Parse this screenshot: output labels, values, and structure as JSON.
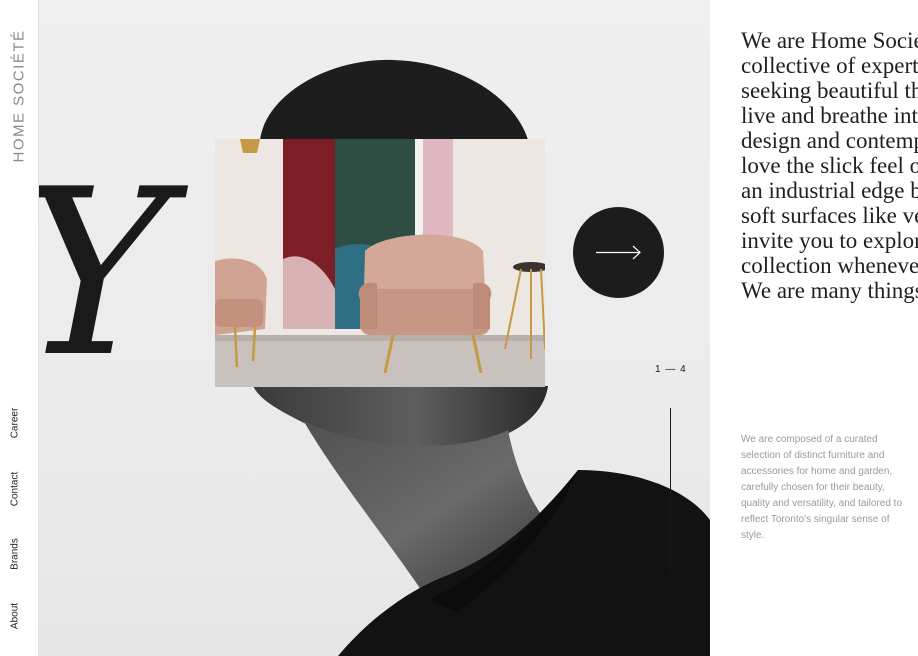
{
  "brand": {
    "logo_text": "HOME SOCIÉTÉ"
  },
  "nav": {
    "items": [
      {
        "label": "Career"
      },
      {
        "label": "Contact"
      },
      {
        "label": "Brands"
      },
      {
        "label": "About"
      }
    ]
  },
  "hero": {
    "big_letter": "Y",
    "next_icon": "arrow-right-icon",
    "pager": "1 — 4"
  },
  "intro": {
    "text": "We are Home Société, a collective of expertise while seeking beautiful things. We live and breathe international design and contemporary. We love the slick feel of metal and an industrial edge but we like soft surfaces like velvet, too. We invite you to explore and the collection whenever you need it. We are many things."
  },
  "description": {
    "text": "We are composed of a curated selection of distinct furniture and accessories for home and garden, carefully chosen for their beauty, quality and versatility, and tailored to reflect Toronto's singular sense of style."
  },
  "colors": {
    "accent_dark": "#1c1c1c",
    "text_muted": "#9a9a9a",
    "chair_pink": "#d4a898"
  }
}
